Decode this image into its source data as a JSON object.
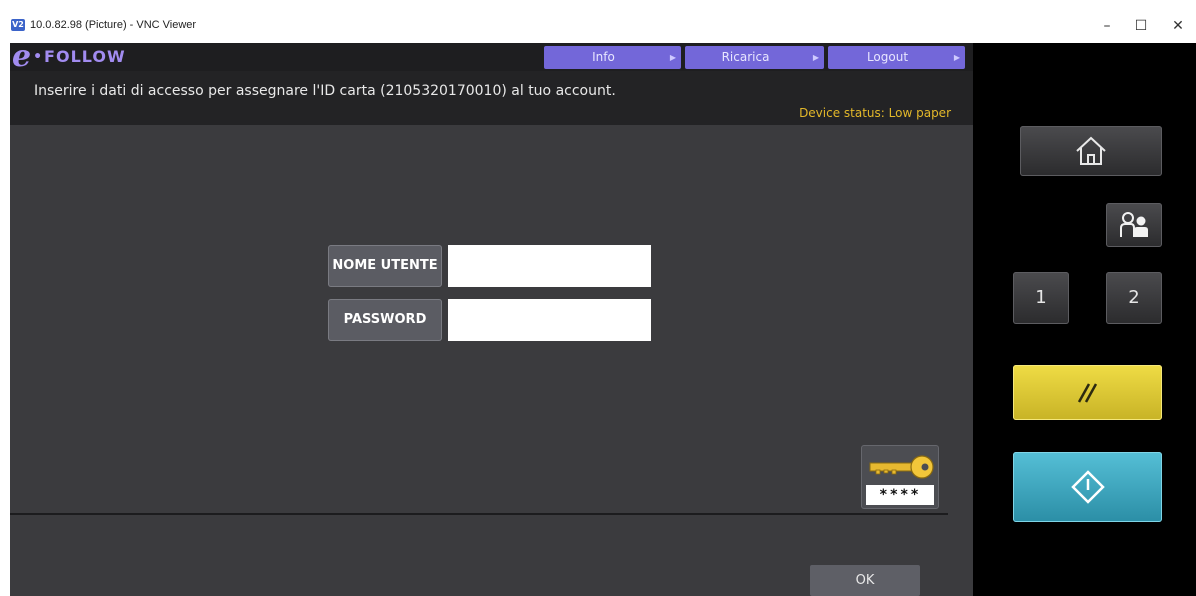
{
  "window": {
    "title": "10.0.82.98 (Picture) - VNC Viewer",
    "app_icon_text": "V2",
    "controls": {
      "minimize": "–",
      "maximize": "☐",
      "close": "✕"
    }
  },
  "header": {
    "logo": {
      "e": "e",
      "dot": "•",
      "text": "FOLLOW"
    },
    "nav": [
      {
        "label": "Info",
        "arrow": "▶"
      },
      {
        "label": "Ricarica",
        "arrow": "▶"
      },
      {
        "label": "Logout",
        "arrow": "▶"
      }
    ],
    "message": "Inserire i dati di accesso per assegnare l'ID carta (2105320170010) al tuo account.",
    "device_status": "Device status: Low paper"
  },
  "form": {
    "username_label": "NOME UTENTE",
    "username_value": "",
    "password_label": "PASSWORD",
    "password_value": ""
  },
  "key_button": {
    "stars": "****"
  },
  "ok_label": "OK",
  "side_panel": {
    "num1": "1",
    "num2": "2"
  },
  "colors": {
    "accent": "#7367d9",
    "status": "#e3b82a",
    "reset_button": "#e2cf3c",
    "start_button": "#41a7bd"
  }
}
